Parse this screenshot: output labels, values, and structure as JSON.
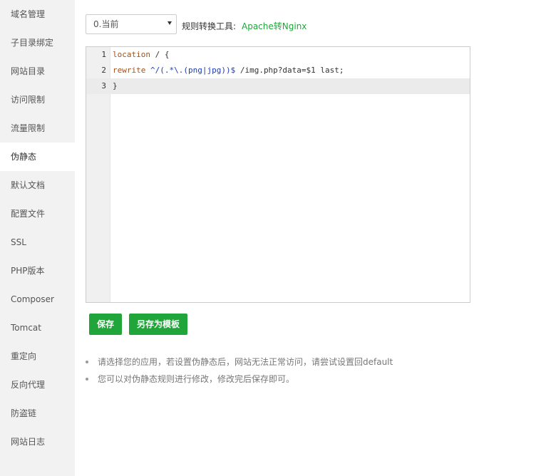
{
  "sidebar": {
    "items": [
      {
        "label": "域名管理"
      },
      {
        "label": "子目录绑定"
      },
      {
        "label": "网站目录"
      },
      {
        "label": "访问限制"
      },
      {
        "label": "流量限制"
      },
      {
        "label": "伪静态",
        "active": true
      },
      {
        "label": "默认文档"
      },
      {
        "label": "配置文件"
      },
      {
        "label": "SSL"
      },
      {
        "label": "PHP版本"
      },
      {
        "label": "Composer"
      },
      {
        "label": "Tomcat"
      },
      {
        "label": "重定向"
      },
      {
        "label": "反向代理"
      },
      {
        "label": "防盗链"
      },
      {
        "label": "网站日志"
      }
    ]
  },
  "toolbar": {
    "version_select": "0.当前",
    "tool_label": "规则转换工具:",
    "tool_link": "Apache转Nginx"
  },
  "editor": {
    "line_numbers": [
      "1",
      "2",
      "3"
    ],
    "line1": {
      "kw": "location",
      "rest": " / {"
    },
    "line2": {
      "kw": "rewrite",
      "regex": " ^/(.*\\.(png|jpg))$",
      "rest": " /img.php?data=$1 last;"
    },
    "line3": {
      "rest": "}"
    }
  },
  "buttons": {
    "save": "保存",
    "save_as_template": "另存为模板"
  },
  "tips": [
    "请选择您的应用，若设置伪静态后，网站无法正常访问，请尝试设置回default",
    "您可以对伪静态规则进行修改，修改完后保存即可。"
  ],
  "colors": {
    "accent": "#20a53a",
    "sidebar_bg": "#f2f2f2",
    "active_line_bg": "#ebebeb"
  }
}
